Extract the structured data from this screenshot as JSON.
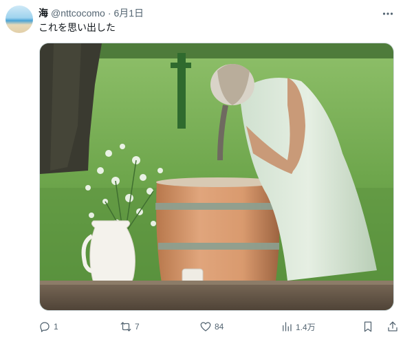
{
  "tweet": {
    "author_name": "海",
    "handle": "@nttcocomo",
    "separator": "·",
    "date": "6月1日",
    "text": "これを思い出した"
  },
  "media": {
    "scene": "photo"
  },
  "actions": {
    "reply_count": "1",
    "retweet_count": "7",
    "like_count": "84",
    "view_count": "1.4万"
  },
  "colors": {
    "text_primary": "#0f1419",
    "text_secondary": "#536471",
    "border": "#cfd9de"
  }
}
